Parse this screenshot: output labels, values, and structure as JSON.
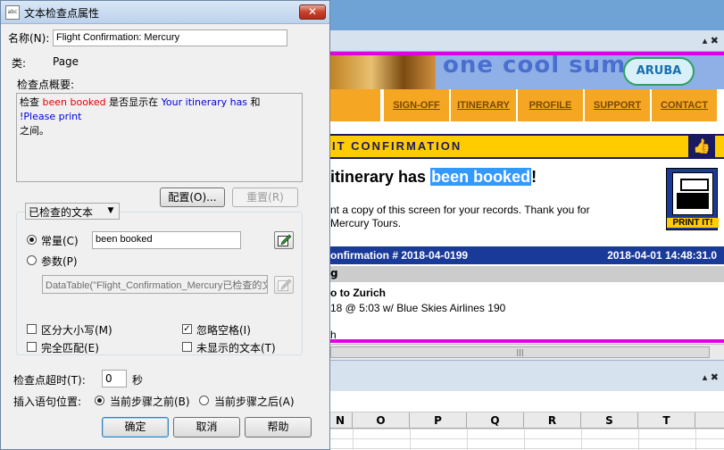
{
  "dialog": {
    "title": "文本检查点属性",
    "title_icon_text": "abc",
    "name_label": "名称(N):",
    "name_value": "Flight Confirmation: Mercury",
    "class_label": "类:",
    "class_value": "Page",
    "summary_label": "检查点概要:",
    "summary": {
      "p1": "检查 ",
      "checked_text": "been booked",
      "p2": " 是否显示在 ",
      "before_text": "Your itinerary has",
      "p3": " 和 ",
      "after_text": "!Please print",
      "p4": "之间。"
    },
    "config_button": "配置(O)...",
    "reset_button": "重置(R)",
    "group_combo": "已检查的文本",
    "constant_label": "常量(C)",
    "constant_value": "been booked",
    "parameter_label": "参数(P)",
    "parameter_value": "DataTable(\"Flight_Confirmation_Mercury已检查的文",
    "case_sensitive_label": "区分大小写(M)",
    "ignore_spaces_label": "忽略空格(I)",
    "exact_match_label": "完全匹配(E)",
    "text_not_displayed_label": "未显示的文本(T)",
    "timeout_label": "检查点超时(T):",
    "timeout_value": "0",
    "timeout_unit": "秒",
    "insert_label": "插入语句位置:",
    "before_step_label": "当前步骤之前(B)",
    "after_step_label": "当前步骤之后(A)",
    "ok_button": "确定",
    "cancel_button": "取消",
    "help_button": "帮助",
    "checkmark": "✓",
    "close_glyph": "✕",
    "combo_arrow": "▼"
  },
  "background_app": {
    "pin_glyph": "▴ ✖",
    "banner_text": "one cool summer",
    "banner_logo": "ARUBA",
    "nav": [
      "SIGN-OFF",
      "ITINERARY",
      "PROFILE",
      "SUPPORT",
      "CONTACT"
    ],
    "confirmation_title": "IT CONFIRMATION",
    "thumb_glyph": "👍",
    "itinerary_prefix": "itinerary has ",
    "itinerary_highlight": "been booked",
    "itinerary_suffix": "!",
    "itinerary_line1": "nt a copy of this screen for your records. Thank you for",
    "itinerary_line2": "Mercury Tours.",
    "print_label": "PRINT IT!",
    "confirmation_number": "onfirmation # 2018-04-0199",
    "confirmation_datetime": "2018-04-01 14:48:31.0",
    "grey_row_text": "g",
    "flight_title": "o to Zurich",
    "flight_detail": "18 @ 5:03 w/ Blue Skies Airlines 190",
    "h_fragment": "h",
    "scroll_grip": "|||",
    "columns": [
      "N",
      "O",
      "P",
      "Q",
      "R",
      "S",
      "T"
    ]
  }
}
